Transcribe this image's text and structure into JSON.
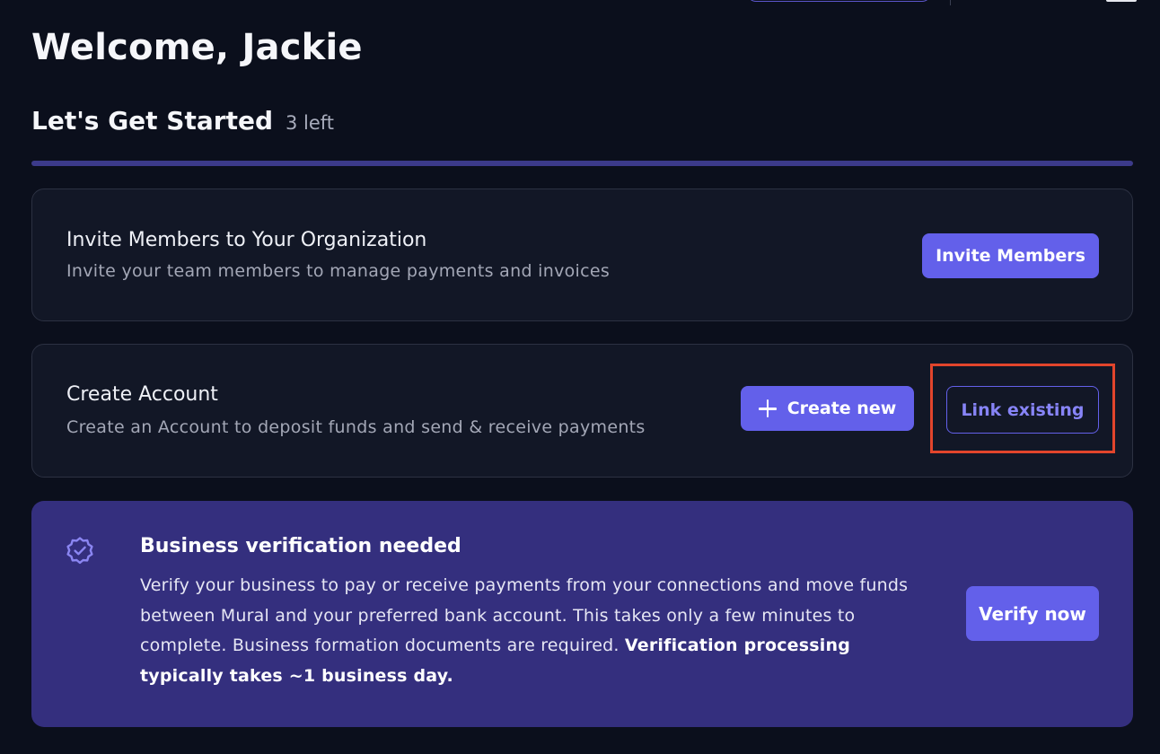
{
  "header": {
    "welcome": "Welcome, Jackie"
  },
  "getting_started": {
    "title": "Let's Get Started",
    "remaining": "3 left"
  },
  "invite_card": {
    "title": "Invite Members to Your Organization",
    "description": "Invite your team members to manage payments and invoices",
    "button_label": "Invite Members"
  },
  "account_card": {
    "title": "Create Account",
    "description": "Create an Account to deposit funds and send & receive payments",
    "create_label": "Create new",
    "link_label": "Link existing"
  },
  "verification": {
    "icon": "badge-check-icon",
    "title": "Business verification needed",
    "body": "Verify your business to pay or receive payments from your connections and move funds between Mural and your preferred bank account. This takes only a few minutes to complete. Business formation documents are required. ",
    "body_emphasis": "Verification processing typically takes ~1 business day.",
    "button_label": "Verify now"
  },
  "colors": {
    "background": "#0b0f1c",
    "card": "#121726",
    "accent": "#6360ea",
    "banner": "#342f7e",
    "highlight": "#e2452c"
  }
}
